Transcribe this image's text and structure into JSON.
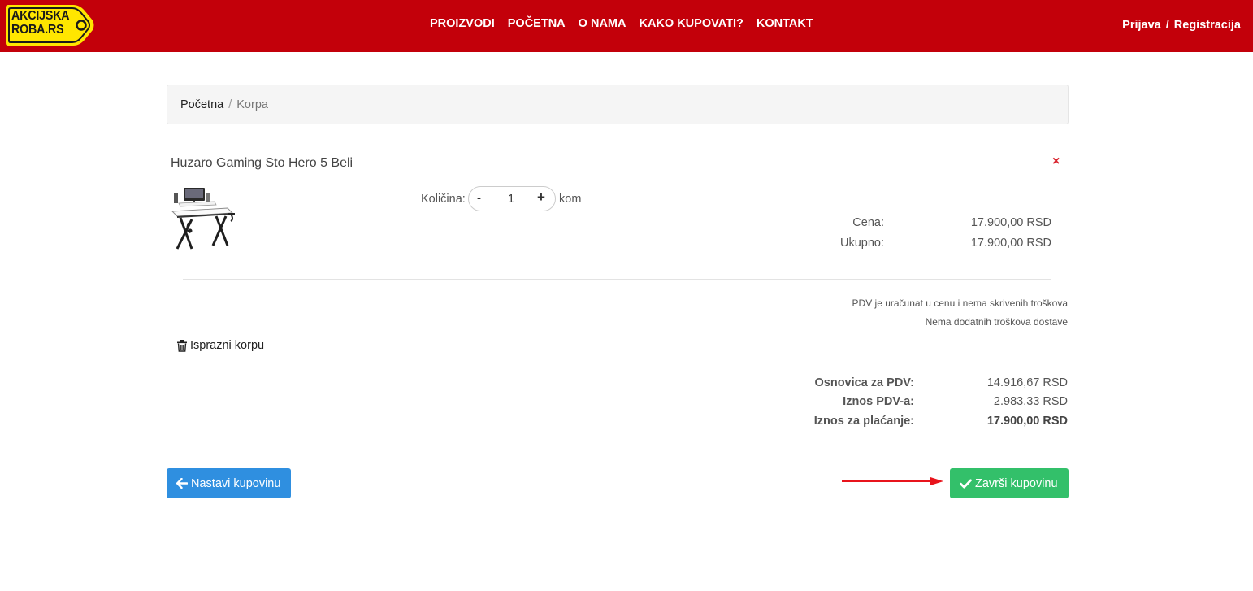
{
  "header": {
    "logo": {
      "line1": "AKCIJSKA",
      "line2": "ROBA.RS"
    },
    "nav": [
      "PROIZVODI",
      "POČETNA",
      "O NAMA",
      "KAKO KUPOVATI?",
      "KONTAKT"
    ],
    "login": "Prijava",
    "separator": "/",
    "register": "Registracija"
  },
  "breadcrumb": {
    "home": "Početna",
    "separator": "/",
    "current": "Korpa"
  },
  "item": {
    "title": "Huzaro Gaming Sto Hero 5 Beli",
    "remove_symbol": "×",
    "quantity_label": "Količina:",
    "minus": "-",
    "quantity": "1",
    "plus": "+",
    "unit": "kom",
    "price_label": "Cena:",
    "price": "17.900,00 RSD",
    "total_label": "Ukupno:",
    "total": "17.900,00 RSD"
  },
  "notes": [
    "PDV je uračunat u cenu i nema skrivenih troškova",
    "Nema dodatnih troškova dostave"
  ],
  "clear_cart": "Isprazni korpu",
  "summary": {
    "base_label": "Osnovica za PDV:",
    "base_value": "14.916,67 RSD",
    "vat_label": "Iznos PDV-a:",
    "vat_value": "2.983,33 RSD",
    "pay_label": "Iznos za plaćanje:",
    "pay_value": "17.900,00 RSD"
  },
  "buttons": {
    "continue": "Nastavi kupovinu",
    "finish": "Završi kupovinu"
  },
  "colors": {
    "header_bg": "#c3000a",
    "logo_yellow": "#ffe600",
    "continue_bg": "#2f8fe0",
    "finish_bg": "#33c06a",
    "remove_red": "#d9232d",
    "annotation_arrow": "#e8141c"
  }
}
